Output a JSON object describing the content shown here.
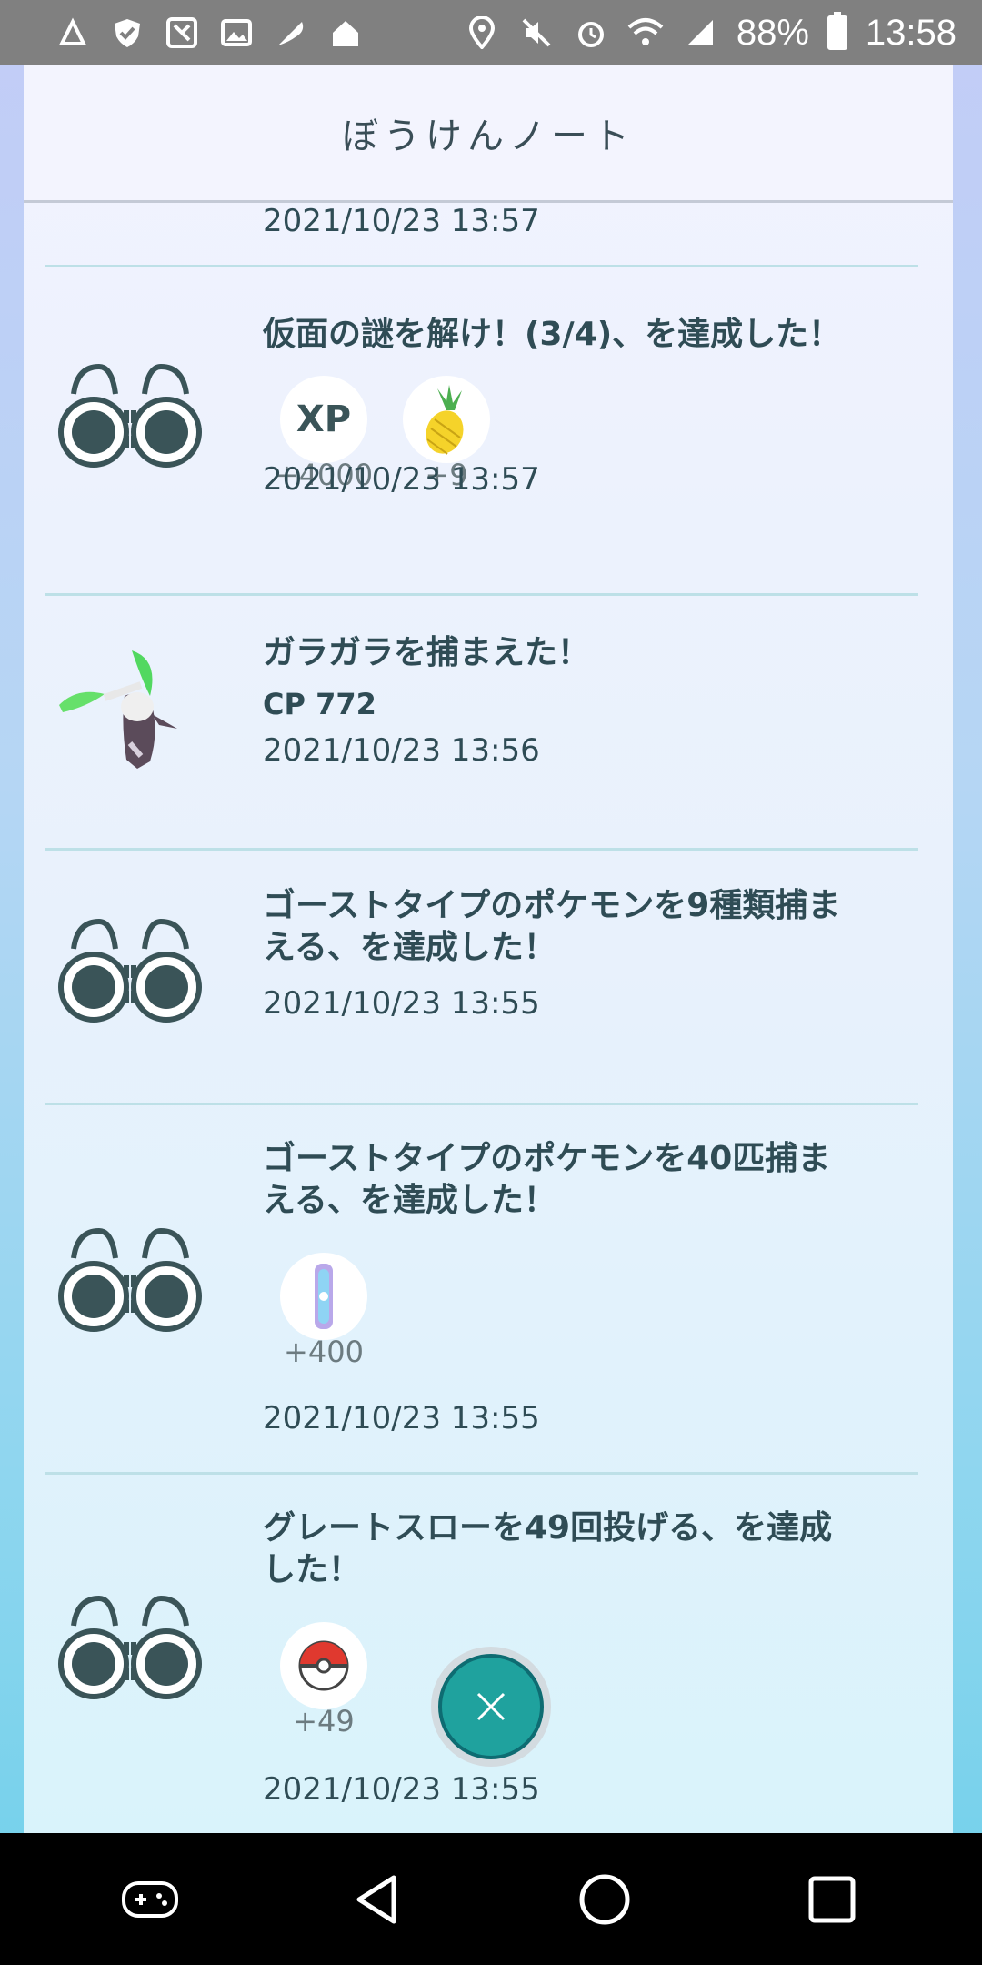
{
  "status_bar": {
    "battery": "88%",
    "time": "13:58"
  },
  "header": {
    "title": "ぼうけんノート"
  },
  "top_partial": {
    "date": "2021/10/23 13:57"
  },
  "entries": [
    {
      "title": "仮面の謎を解け！(3/4)、を達成した！",
      "rewards": [
        {
          "icon": "xp-icon",
          "label": "XP",
          "count": "+4000"
        },
        {
          "icon": "pineapple-icon",
          "count": "+9"
        }
      ],
      "date": "2021/10/23 13:57"
    },
    {
      "title": "ガラガラを捕まえた！",
      "cp": "CP 772",
      "date": "2021/10/23 13:56"
    },
    {
      "title_line1": "ゴーストタイプのポケモンを9種類捕ま",
      "title_line2": "える、を達成した！",
      "date": "2021/10/23 13:55"
    },
    {
      "title_line1": "ゴーストタイプのポケモンを40匹捕ま",
      "title_line2": "える、を達成した！",
      "rewards": [
        {
          "icon": "stardust-icon",
          "count": "+400"
        }
      ],
      "date": "2021/10/23 13:55"
    },
    {
      "title_line1": "グレートスローを49回投げる、を達成",
      "title_line2": "した！",
      "rewards": [
        {
          "icon": "pokeball-icon",
          "count": "+49"
        }
      ],
      "date": "2021/10/23 13:55"
    }
  ],
  "colors": {
    "accent": "#1fa29e",
    "text": "#2f4c55",
    "divider": "#bde0e7"
  }
}
